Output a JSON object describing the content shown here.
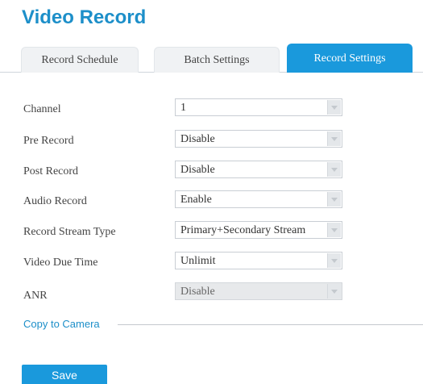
{
  "page": {
    "title": "Video Record"
  },
  "tabs": [
    {
      "label": "Record Schedule",
      "active": false
    },
    {
      "label": "Batch Settings",
      "active": false
    },
    {
      "label": "Record Settings",
      "active": true
    }
  ],
  "form": {
    "channel": {
      "label": "Channel",
      "value": "1",
      "disabled": false
    },
    "pre_record": {
      "label": "Pre Record",
      "value": "Disable",
      "disabled": false
    },
    "post_record": {
      "label": "Post Record",
      "value": "Disable",
      "disabled": false
    },
    "audio_record": {
      "label": "Audio Record",
      "value": "Enable",
      "disabled": false
    },
    "record_stream_type": {
      "label": "Record Stream Type",
      "value": "Primary+Secondary Stream",
      "disabled": false
    },
    "video_due_time": {
      "label": "Video Due Time",
      "value": "Unlimit",
      "disabled": false
    },
    "anr": {
      "label": "ANR",
      "value": "Disable",
      "disabled": true
    }
  },
  "copy_to_camera": {
    "label": "Copy to Camera"
  },
  "actions": {
    "save_label": "Save"
  },
  "colors": {
    "accent": "#1a99dc",
    "title": "#1d8fc9",
    "disabled_field": "#e7e9eb"
  }
}
